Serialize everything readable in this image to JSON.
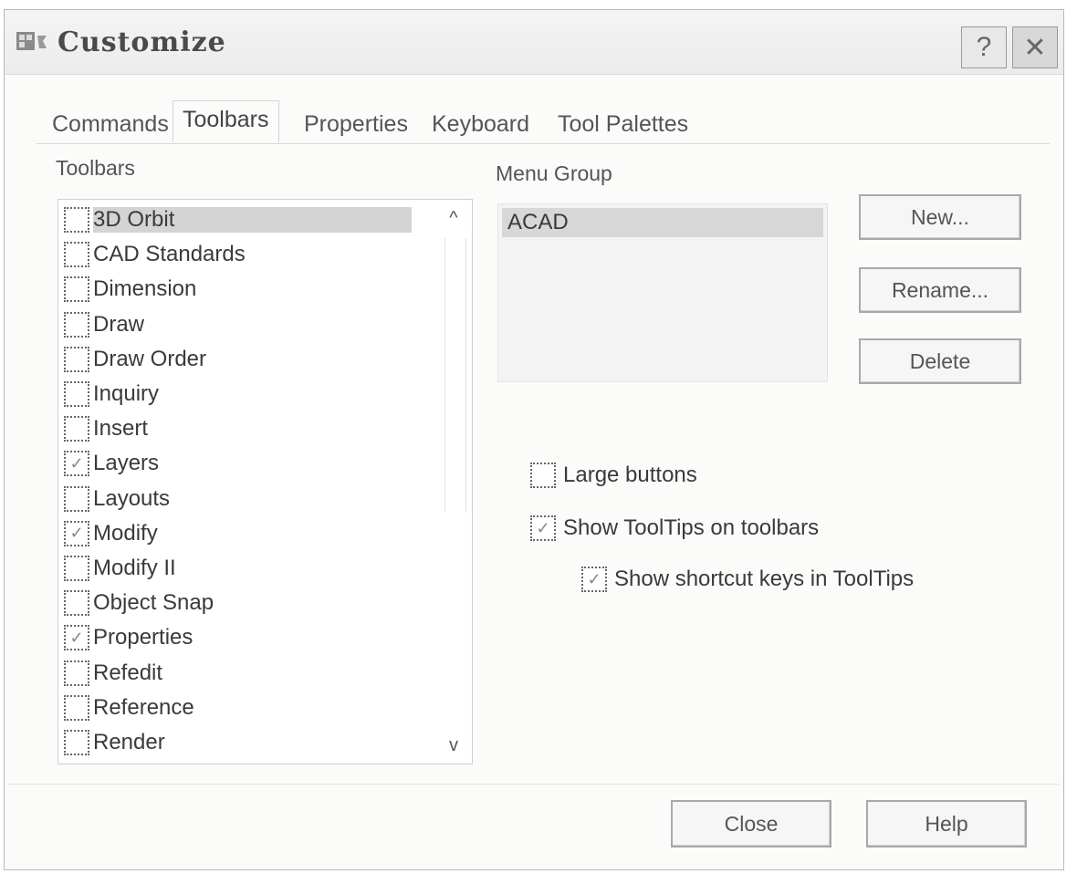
{
  "window": {
    "title": "Customize",
    "help_glyph": "?",
    "close_glyph": "✕"
  },
  "tabs": [
    {
      "label": "Commands",
      "active": false
    },
    {
      "label": "Toolbars",
      "active": true
    },
    {
      "label": "Properties",
      "active": false
    },
    {
      "label": "Keyboard",
      "active": false
    },
    {
      "label": "Tool Palettes",
      "active": false
    }
  ],
  "toolbars_panel": {
    "label": "Toolbars",
    "items": [
      {
        "label": "3D Orbit",
        "checked": false,
        "selected": true
      },
      {
        "label": "CAD Standards",
        "checked": false
      },
      {
        "label": "Dimension",
        "checked": false
      },
      {
        "label": "Draw",
        "checked": false
      },
      {
        "label": "Draw Order",
        "checked": false
      },
      {
        "label": "Inquiry",
        "checked": false
      },
      {
        "label": "Insert",
        "checked": false
      },
      {
        "label": "Layers",
        "checked": true
      },
      {
        "label": "Layouts",
        "checked": false
      },
      {
        "label": "Modify",
        "checked": true
      },
      {
        "label": "Modify II",
        "checked": false
      },
      {
        "label": "Object Snap",
        "checked": false
      },
      {
        "label": "Properties",
        "checked": true
      },
      {
        "label": "Refedit",
        "checked": false
      },
      {
        "label": "Reference",
        "checked": false
      },
      {
        "label": "Render",
        "checked": false
      }
    ],
    "scroll_up_glyph": "^",
    "scroll_down_glyph": "v"
  },
  "menu_group": {
    "label": "Menu Group",
    "items": [
      "ACAD"
    ]
  },
  "buttons": {
    "new": "New...",
    "rename": "Rename...",
    "delete": "Delete",
    "close": "Close",
    "help": "Help"
  },
  "options": {
    "large_buttons": {
      "label": "Large buttons",
      "checked": false
    },
    "show_tooltips": {
      "label": "Show ToolTips on toolbars",
      "checked": true
    },
    "show_shortcut_keys": {
      "label": "Show shortcut keys in ToolTips",
      "checked": true
    }
  },
  "check_glyph": "✓"
}
